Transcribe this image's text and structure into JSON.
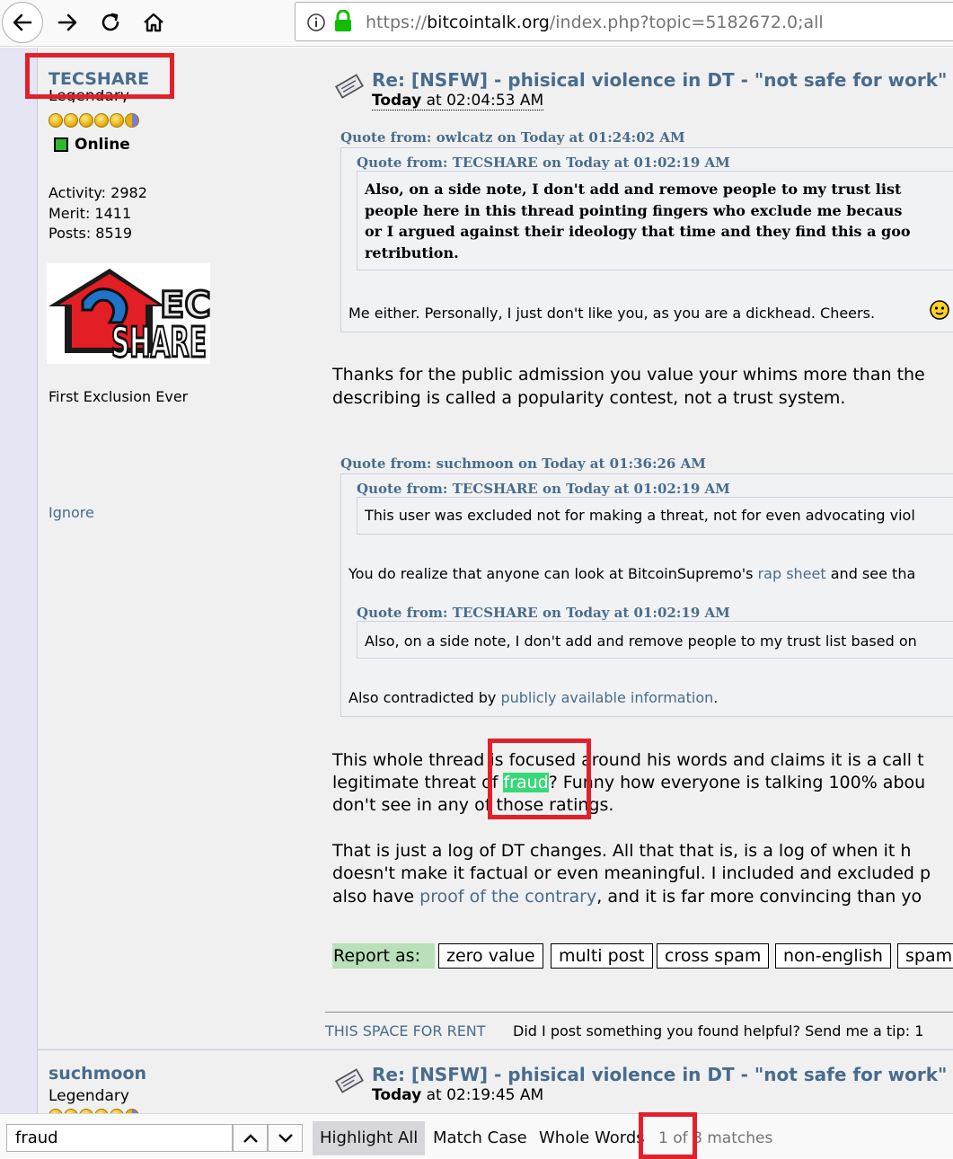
{
  "browser": {
    "url_scheme": "https://",
    "url_host": "bitcointalk.org",
    "url_path": "/index.php?topic=5182672.0;all"
  },
  "post1": {
    "author": {
      "name": "TECSHARE",
      "rank": "Legendary",
      "status": "Online",
      "activity": "Activity: 2982",
      "merit": "Merit: 1411",
      "posts": "Posts: 8519",
      "avatar_text_top": "EC",
      "avatar_text_main": "SHARE",
      "personal_text": "First Exclusion Ever",
      "ignore_label": "Ignore"
    },
    "subject": "Re: [NSFW] - phisical violence in DT - \"not safe for work\" cor",
    "date_prefix": "Today",
    "date_suffix": " at 02:04:53 AM",
    "quote1": {
      "header": "Quote from: owlcatz on Today at 01:24:02 AM",
      "inner_header": "Quote from: TECSHARE on Today at 01:02:19 AM",
      "inner_lines": [
        "Also, on a side note, I don't add and remove people to my trust list",
        "people here in this thread pointing fingers who exclude me becaus",
        "or I argued against their ideology that time and they find this a goo",
        "retribution."
      ],
      "reply": "Me either. Personally, I just don't like you, as you are a dickhead. Cheers."
    },
    "para1": [
      "Thanks for the public admission you value your whims more than the",
      "describing is called a popularity contest, not a trust system."
    ],
    "quote2": {
      "header": "Quote from: suchmoon on Today at 01:36:26 AM",
      "inner1_header": "Quote from: TECSHARE on Today at 01:02:19 AM",
      "inner1_text": "This user was excluded not for making a threat, not for even advocating viol",
      "mid_before": "You do realize that anyone can look at BitcoinSupremo's ",
      "mid_link": "rap sheet",
      "mid_after": " and see tha",
      "inner2_header": "Quote from: TECSHARE on Today at 01:02:19 AM",
      "inner2_text": "Also, on a side note, I don't add and remove people to my trust list based on",
      "end_before": "Also contradicted by ",
      "end_link": "publicly available information",
      "end_after": "."
    },
    "para2": {
      "line1": "This whole thread is focused around his words and claims it is a call t",
      "line2_before": "legitimate threat of ",
      "line2_match": "fraud",
      "line2_after": "? Funny how everyone is talking 100% abou",
      "line3": "don't see in any of those ratings."
    },
    "para3": {
      "line1": "That is just a log of DT changes. All that that is, is a log of when it h",
      "line2": "doesn't make it factual or even meaningful. I included and excluded p",
      "line3_before": "also have ",
      "line3_link": "proof of the contrary",
      "line3_after": ", and it is far more convincing than yo"
    },
    "report": {
      "label": "Report as:",
      "buttons": [
        "zero value",
        "multi post",
        "cross spam",
        "non-english",
        "spam"
      ]
    },
    "signature": {
      "rent": "THIS SPACE FOR RENT",
      "tip": "Did I post something you found helpful? Send me a tip: 1"
    }
  },
  "post2": {
    "author_name": "suchmoon",
    "author_rank": "Legendary",
    "subject": "Re: [NSFW] - phisical violence in DT - \"not safe for work\" cor",
    "date_prefix": "Today",
    "date_suffix": " at 02:19:45 AM"
  },
  "findbar": {
    "query": "fraud",
    "highlight_all": "Highlight All",
    "match_case": "Match Case",
    "whole_words": "Whole Words",
    "match_current": "1 of",
    "match_total": "8 matches"
  },
  "colors": {
    "forum_link": "#476c8e",
    "match_highlight": "#38d878",
    "annotation_red": "#e3202a",
    "online_green": "#2fb82f"
  }
}
